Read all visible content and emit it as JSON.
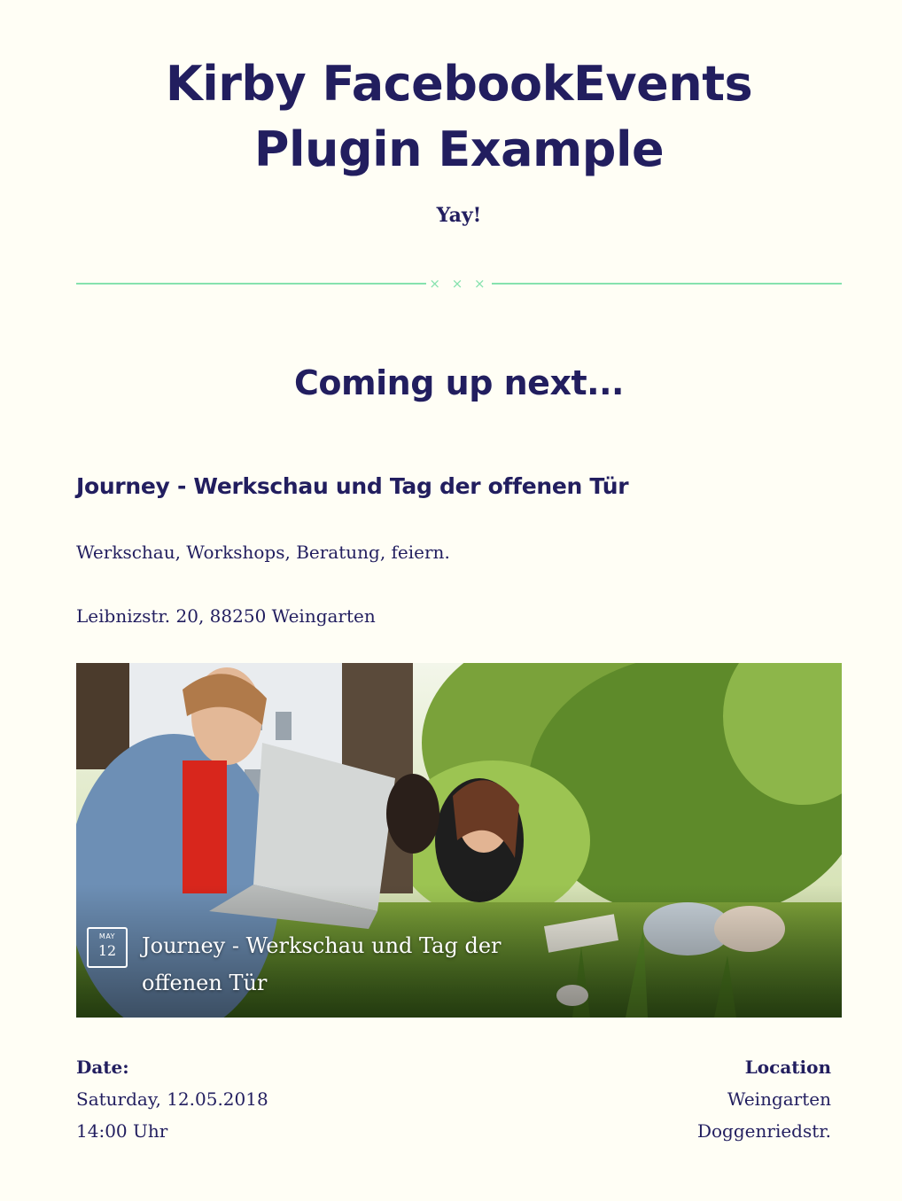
{
  "header": {
    "title": "Kirby FacebookEvents Plugin Example",
    "subtitle": "Yay!",
    "divider_marks": "× × ×"
  },
  "section": {
    "heading": "Coming up next..."
  },
  "event": {
    "title": "Journey - Werkschau und Tag der offenen Tür",
    "description": "Werkschau, Workshops, Beratung, feiern.",
    "address": "Leibnizstr. 20, 88250 Weingarten",
    "card": {
      "month": "MAY",
      "day": "12",
      "title": "Journey - Werkschau und Tag der offenen Tür"
    },
    "details": {
      "date_label": "Date:",
      "date_value": "Saturday, 12.05.2018",
      "time_value": "14:00 Uhr",
      "location_label": "Location",
      "location_city": "Weingarten",
      "location_street": "Doggenriedstr."
    }
  },
  "colors": {
    "text": "#221e5f",
    "background": "#fffef5",
    "accent": "#86e2ae"
  }
}
